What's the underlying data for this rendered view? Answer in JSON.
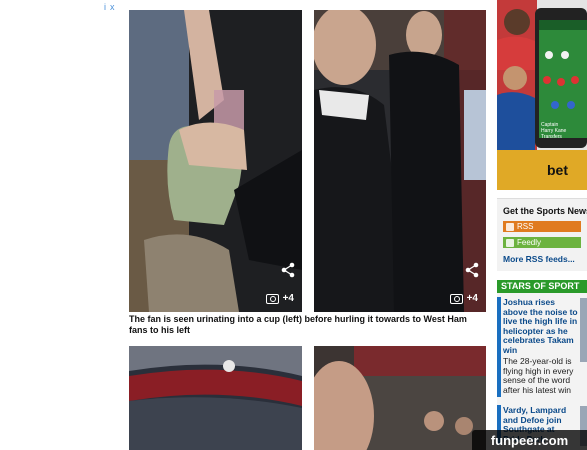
{
  "ad": {
    "adchoices": "i",
    "close": "x"
  },
  "photos": {
    "top_left": {
      "share": "share",
      "count": "+4"
    },
    "top_right": {
      "share": "share",
      "count": "+4"
    }
  },
  "caption": "The fan is seen urinating into a cup (left) before hurling it towards to West Ham fans to his left",
  "sidebar": {
    "bet_brand": "bet",
    "phone_labels": [
      "Captain",
      "Harry Kane",
      "Transfers"
    ],
    "sports_news": {
      "title": "Get the Sports News",
      "rss_label": "RSS",
      "feedly_label": "Feedly",
      "more_link": "More RSS feeds..."
    },
    "stars_of_sport": {
      "header": "STARS OF SPORT",
      "stories": [
        {
          "headline": "Joshua rises above the noise to live the high life in helicopter as he celebrates Takam win",
          "summary": "The 28-year-old is flying high in every sense of the word after his latest win"
        },
        {
          "headline": "Vardy, Lampard and Defoe join Southgate at Pride Park",
          "summary": ""
        }
      ]
    }
  },
  "watermark": "funpeer.com",
  "colors": {
    "rss": "#e07b20",
    "feedly": "#6cb33f",
    "stars_header": "#2a9a2a",
    "link": "#0b4a8a"
  }
}
